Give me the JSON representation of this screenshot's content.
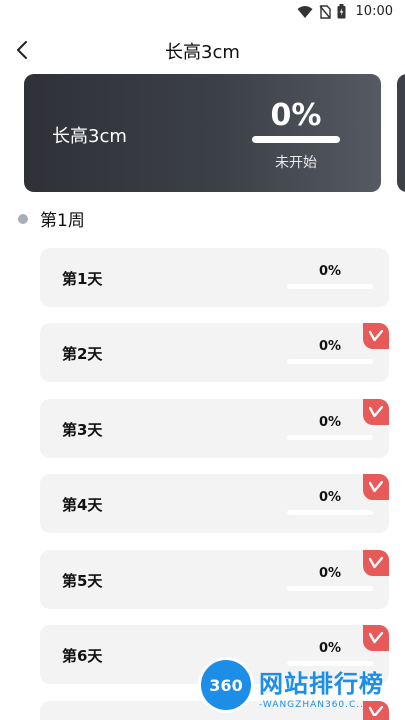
{
  "status_bar": {
    "time": "10:00",
    "icons": [
      "wifi-icon",
      "no-sim-icon",
      "battery-icon"
    ]
  },
  "nav": {
    "title": "长高3cm",
    "back_icon": "chevron-left-icon"
  },
  "hero": {
    "name": "长高3cm",
    "percent": "0%",
    "status": "未开始",
    "progress": 0
  },
  "week": {
    "label": "第1周"
  },
  "days": [
    {
      "label": "第1天",
      "percent": "0%",
      "progress": 0,
      "vip": false
    },
    {
      "label": "第2天",
      "percent": "0%",
      "progress": 0,
      "vip": true
    },
    {
      "label": "第3天",
      "percent": "0%",
      "progress": 0,
      "vip": true
    },
    {
      "label": "第4天",
      "percent": "0%",
      "progress": 0,
      "vip": true
    },
    {
      "label": "第5天",
      "percent": "0%",
      "progress": 0,
      "vip": true
    },
    {
      "label": "第6天",
      "percent": "0%",
      "progress": 0,
      "vip": true
    },
    {
      "label": "",
      "percent": "",
      "progress": 0,
      "vip": true
    }
  ],
  "watermark": {
    "logo_text": "360",
    "title": "网站排行榜",
    "subtitle": "-WANGZHAN360.C..."
  },
  "colors": {
    "hero_dark": "#2f3137",
    "card_bg": "#f3f3f3",
    "vip_red": "#e8595a",
    "watermark_blue": "#1d8ee8"
  }
}
